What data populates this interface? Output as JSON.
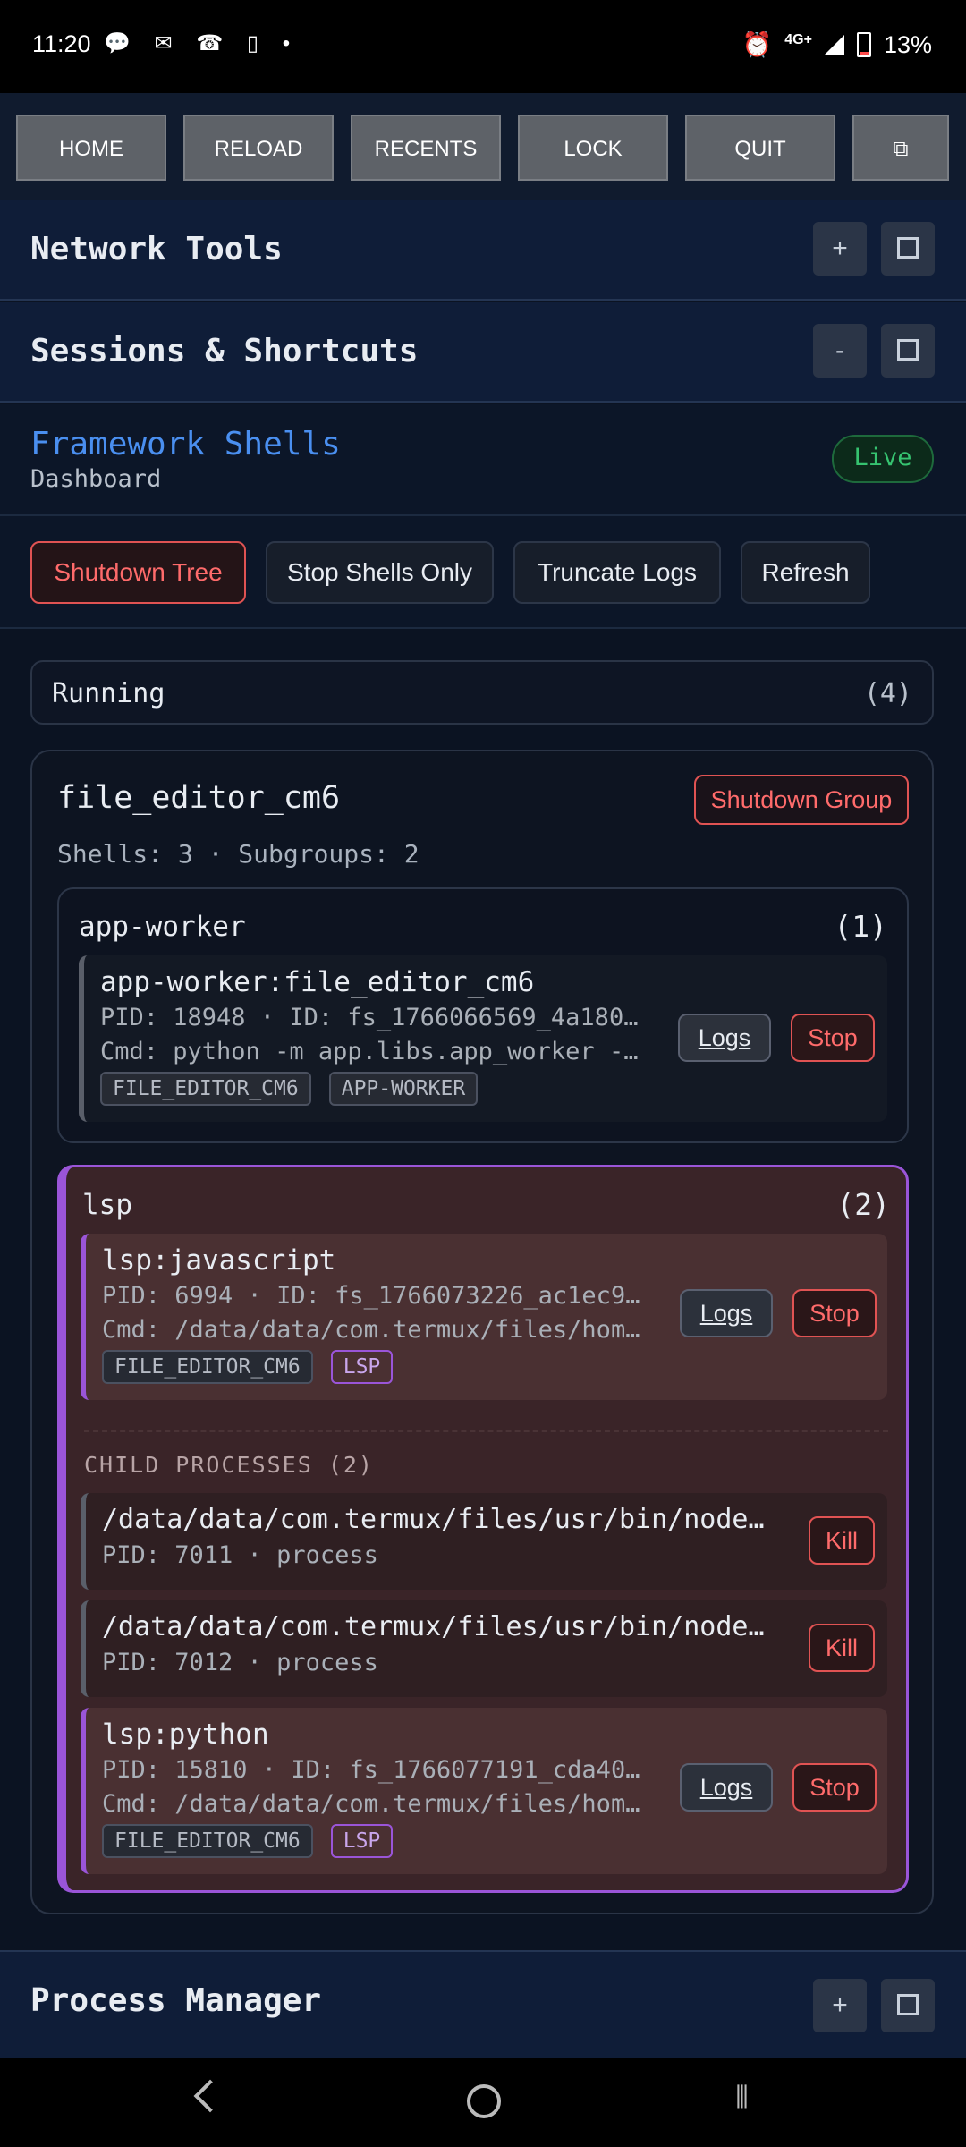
{
  "status_bar": {
    "time": "11:20",
    "left_icons": "💬 ✉ ☎ ▯ •",
    "network": "4G+",
    "battery": "13%"
  },
  "nav": {
    "buttons": [
      "HOME",
      "RELOAD",
      "RECENTS",
      "LOCK",
      "QUIT"
    ],
    "window_icon": "⧉"
  },
  "sections": {
    "network_tools": {
      "title": "Network Tools",
      "toggle": "+"
    },
    "sessions": {
      "title": "Sessions & Shortcuts",
      "toggle": "-"
    },
    "process_manager": {
      "title": "Process Manager",
      "toggle": "+"
    }
  },
  "dashboard": {
    "title": "Framework Shells",
    "subtitle": "Dashboard",
    "status": "Live"
  },
  "actions": {
    "shutdown_tree": "Shutdown Tree",
    "stop_shells": "Stop Shells Only",
    "truncate_logs": "Truncate Logs",
    "refresh": "Refresh"
  },
  "running": {
    "label": "Running",
    "count": "(4)"
  },
  "group": {
    "name": "file_editor_cm6",
    "meta": "Shells: 3 · Subgroups: 2",
    "shutdown_label": "Shutdown Group",
    "subgroups": [
      {
        "name": "app-worker",
        "count": "(1)",
        "processes": [
          {
            "name": "app-worker:file_editor_cm6",
            "info": "PID: 18948 · ID: fs_1766066569_4a180…",
            "cmd": "Cmd: python -m app.libs.app_worker -…",
            "tags": [
              "FILE_EDITOR_CM6",
              "APP-WORKER"
            ]
          }
        ]
      },
      {
        "name": "lsp",
        "count": "(2)",
        "processes": [
          {
            "name": "lsp:javascript",
            "info": "PID: 6994 · ID: fs_1766073226_ac1ec9…",
            "cmd": "Cmd: /data/data/com.termux/files/hom…",
            "tags": [
              "FILE_EDITOR_CM6",
              "LSP"
            ]
          },
          {
            "name": "lsp:python",
            "info": "PID: 15810 · ID: fs_1766077191_cda40…",
            "cmd": "Cmd: /data/data/com.termux/files/hom…",
            "tags": [
              "FILE_EDITOR_CM6",
              "LSP"
            ]
          }
        ],
        "children_heading": "CHILD PROCESSES (2)",
        "children": [
          {
            "path": "/data/data/com.termux/files/usr/bin/node…",
            "info": "PID: 7011 · process"
          },
          {
            "path": "/data/data/com.termux/files/usr/bin/node…",
            "info": "PID: 7012 · process"
          }
        ]
      }
    ]
  },
  "labels": {
    "logs": "Logs",
    "stop": "Stop",
    "kill": "Kill"
  },
  "colors": {
    "accent_blue": "#4a8ff0",
    "danger": "#ff6b6b",
    "live_green": "#36c370",
    "lsp_purple": "#9a55d8"
  }
}
